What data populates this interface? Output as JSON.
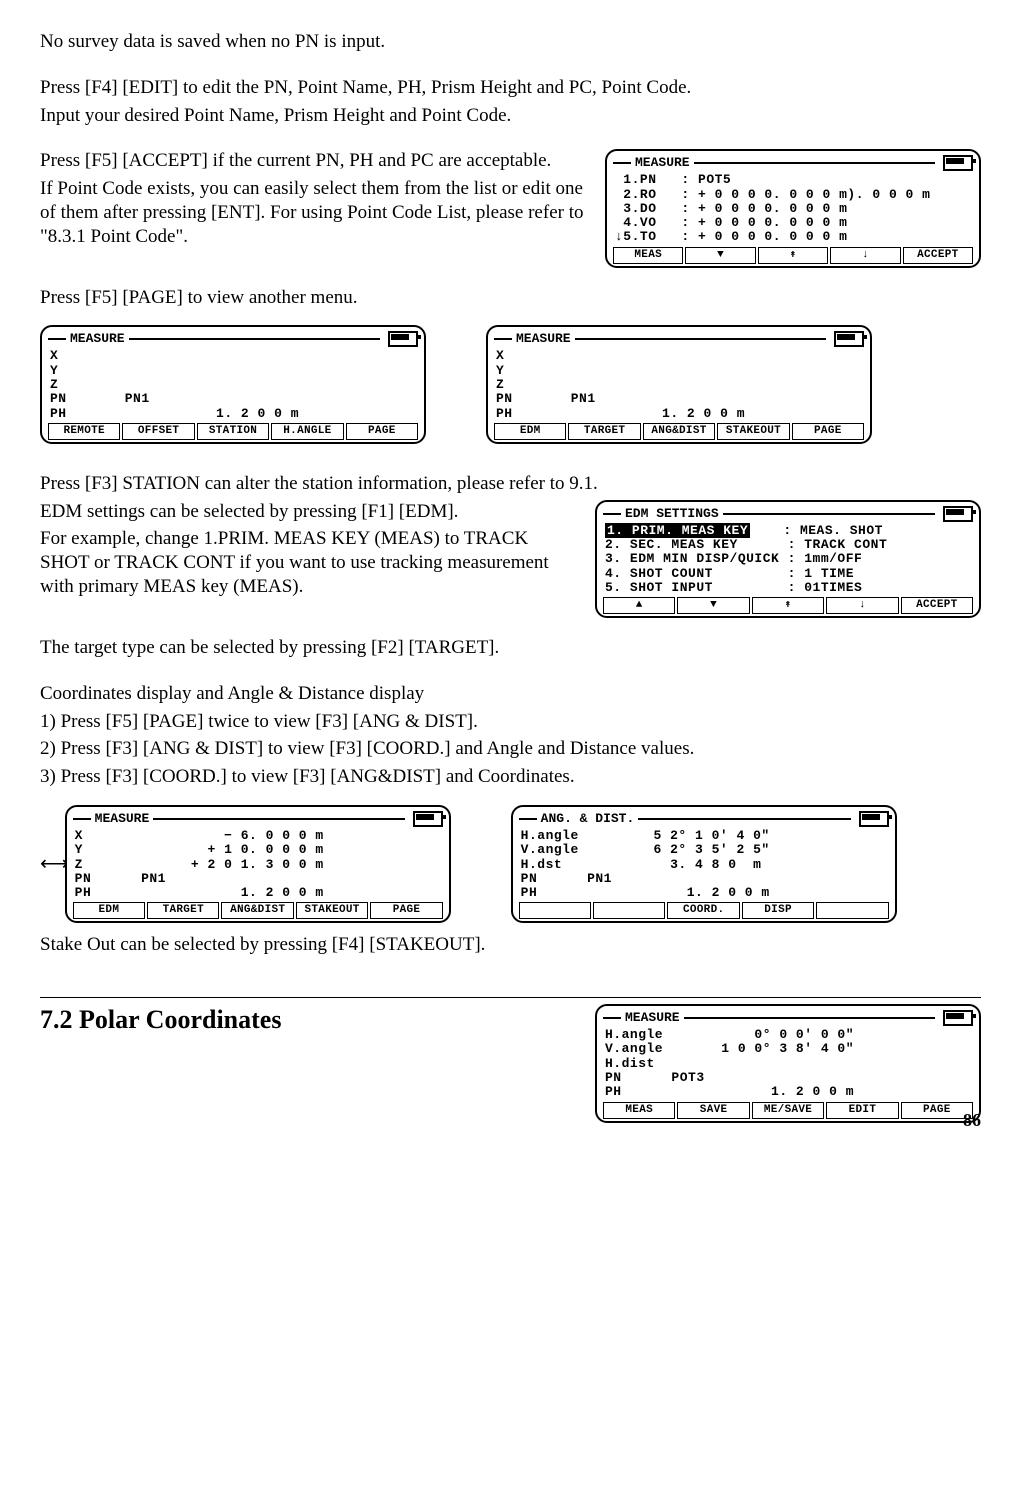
{
  "p0": "No survey data is saved when no PN is input.",
  "p1": "Press [F4] [EDIT] to edit the PN, Point Name, PH, Prism Height and PC, Point Code.",
  "p2": "Input your desired Point Name, Prism Height and Point Code.",
  "p3": "Press [F5] [ACCEPT] if the current PN, PH and PC are acceptable.",
  "p4": "If Point Code exists, you can easily select them from the list or edit one of them after pressing [ENT]. For using Point Code List, please refer to \"8.3.1 Point Code\".",
  "p5": "Press [F5] [PAGE] to view another menu.",
  "p6": "Press [F3] STATION can alter the station information, please refer to 9.1.",
  "p7": "EDM settings can be selected by pressing [F1] [EDM].",
  "p8": "For example, change 1.PRIM. MEAS KEY (MEAS) to TRACK SHOT or TRACK CONT if you want to use tracking measurement with primary MEAS key (MEAS).",
  "p9": "The target type can be selected by pressing [F2] [TARGET].",
  "p10": "Coordinates display and Angle & Distance display",
  "p11": "1) Press [F5] [PAGE] twice to view [F3] [ANG & DIST].",
  "p12": "2) Press [F3] [ANG & DIST] to view [F3] [COORD.] and Angle and Distance values.",
  "p13": "3) Press [F3] [COORD.] to view [F3] [ANG&DIST] and Coordinates.",
  "p14": "Stake Out can be selected by pressing [F4] [STAKEOUT].",
  "h2": "7.2 Polar Coordinates",
  "page_num": "86",
  "shot1": {
    "title": "MEASURE",
    "rows": [
      " 1.PN   : POT5",
      " 2.RO   : + 0 0 0 0. 0 0 0 m). 0 0 0 m",
      " 3.DO   : + 0 0 0 0. 0 0 0 m",
      " 4.VO   : + 0 0 0 0. 0 0 0 m",
      "↓5.TO   : + 0 0 0 0. 0 0 0 m"
    ],
    "foot": [
      "MEAS",
      "▼",
      "↟",
      "↓",
      "ACCEPT"
    ]
  },
  "shot2": {
    "title": "MEASURE",
    "rows": [
      "X",
      "Y",
      "Z",
      "PN       PN1",
      "PH                  1. 2 0 0 m"
    ],
    "foot": [
      "REMOTE",
      "OFFSET",
      "STATION",
      "H.ANGLE",
      "PAGE"
    ]
  },
  "shot3": {
    "title": "MEASURE",
    "rows": [
      "X",
      "Y",
      "Z",
      "PN       PN1",
      "PH                  1. 2 0 0 m"
    ],
    "foot": [
      "EDM",
      "TARGET",
      "ANG&DIST",
      "STAKEOUT",
      "PAGE"
    ]
  },
  "shot4": {
    "title": "EDM SETTINGS",
    "row1_label": "1. PRIM. MEAS KEY",
    "row1_val": ": MEAS. SHOT",
    "rows": [
      "2. SEC. MEAS KEY      : TRACK CONT",
      "3. EDM MIN DISP/QUICK : 1mm/OFF",
      "4. SHOT COUNT         : 1 TIME",
      "5. SHOT INPUT         : 01TIMES"
    ],
    "foot": [
      "▲",
      "▼",
      "↟",
      "↓",
      "ACCEPT"
    ]
  },
  "shot5": {
    "title": "MEASURE",
    "rows": [
      "X                 − 6. 0 0 0 m",
      "Y               + 1 0. 0 0 0 m",
      "Z             + 2 0 1. 3 0 0 m",
      "PN      PN1",
      "PH                  1. 2 0 0 m"
    ],
    "foot": [
      "EDM",
      "TARGET",
      "ANG&DIST",
      "STAKEOUT",
      "PAGE"
    ]
  },
  "shot6": {
    "title": "ANG. & DIST.",
    "rows": [
      "H.angle         5 2° 1 0′ 4 0″",
      "V.angle         6 2° 3 5′ 2 5″",
      "H.dst             3. 4 8 0  m",
      "PN      PN1",
      "PH                  1. 2 0 0 m"
    ],
    "foot": [
      "",
      "",
      "COORD.",
      "DISP",
      ""
    ]
  },
  "shot7": {
    "title": "MEASURE",
    "rows": [
      "H.angle           0° 0 0′ 0 0″",
      "V.angle       1 0 0° 3 8′ 4 0″",
      "H.dist",
      "PN      POT3",
      "PH                  1. 2 0 0 m"
    ],
    "foot": [
      "MEAS",
      "SAVE",
      "ME/SAVE",
      "EDIT",
      "PAGE"
    ]
  }
}
